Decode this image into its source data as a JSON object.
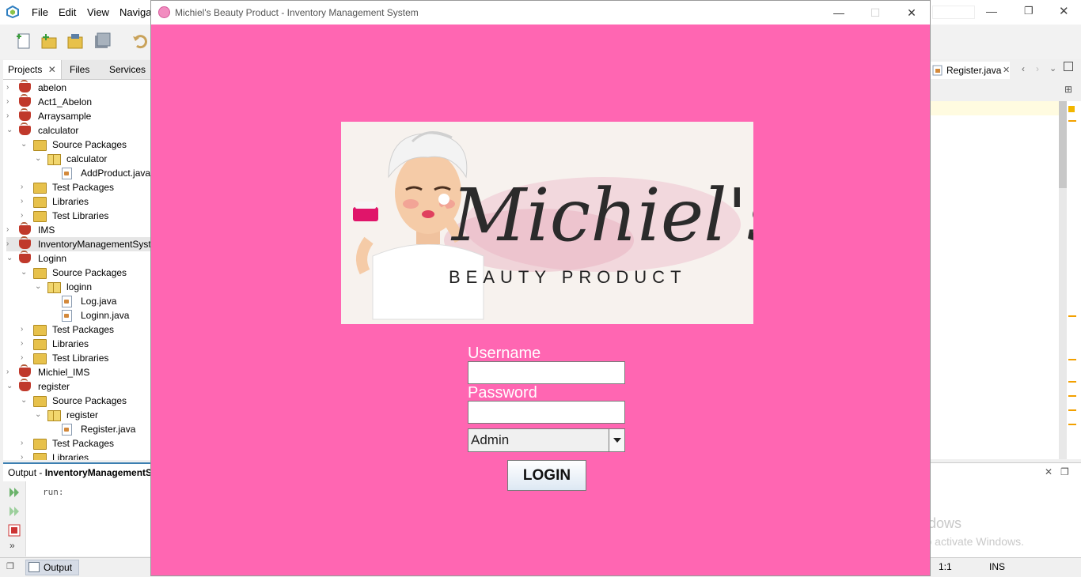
{
  "ide": {
    "menu": [
      "File",
      "Edit",
      "View",
      "Navigat"
    ],
    "left_tabs": [
      "Projects",
      "Files",
      "Services"
    ],
    "tree": [
      {
        "label": "abelon",
        "icon": "project-icon",
        "depth": 0,
        "twisty": "›"
      },
      {
        "label": "Act1_Abelon",
        "icon": "project-icon",
        "depth": 0,
        "twisty": "›"
      },
      {
        "label": "Arraysample",
        "icon": "project-icon",
        "depth": 0,
        "twisty": "›"
      },
      {
        "label": "calculator",
        "icon": "project-icon",
        "depth": 0,
        "twisty": "⌄"
      },
      {
        "label": "Source Packages",
        "icon": "folder-icon",
        "depth": 1,
        "twisty": "⌄"
      },
      {
        "label": "calculator",
        "icon": "package-icon",
        "depth": 2,
        "twisty": "⌄"
      },
      {
        "label": "AddProduct.java",
        "icon": "java-file-icon",
        "depth": 3,
        "twisty": ""
      },
      {
        "label": "Test Packages",
        "icon": "folder-icon",
        "depth": 1,
        "twisty": "›"
      },
      {
        "label": "Libraries",
        "icon": "folder-icon",
        "depth": 1,
        "twisty": "›"
      },
      {
        "label": "Test Libraries",
        "icon": "folder-icon",
        "depth": 1,
        "twisty": "›"
      },
      {
        "label": "IMS",
        "icon": "project-icon",
        "depth": 0,
        "twisty": "›"
      },
      {
        "label": "InventoryManagementSyst",
        "icon": "project-icon",
        "depth": 0,
        "twisty": "›"
      },
      {
        "label": "Loginn",
        "icon": "project-icon",
        "depth": 0,
        "twisty": "⌄"
      },
      {
        "label": "Source Packages",
        "icon": "folder-icon",
        "depth": 1,
        "twisty": "⌄"
      },
      {
        "label": "loginn",
        "icon": "package-icon",
        "depth": 2,
        "twisty": "⌄"
      },
      {
        "label": "Log.java",
        "icon": "java-file-icon",
        "depth": 3,
        "twisty": ""
      },
      {
        "label": "Loginn.java",
        "icon": "java-file-icon",
        "depth": 3,
        "twisty": ""
      },
      {
        "label": "Test Packages",
        "icon": "folder-icon",
        "depth": 1,
        "twisty": "›"
      },
      {
        "label": "Libraries",
        "icon": "folder-icon",
        "depth": 1,
        "twisty": "›"
      },
      {
        "label": "Test Libraries",
        "icon": "folder-icon",
        "depth": 1,
        "twisty": "›"
      },
      {
        "label": "Michiel_IMS",
        "icon": "project-icon",
        "depth": 0,
        "twisty": "›"
      },
      {
        "label": "register",
        "icon": "project-icon",
        "depth": 0,
        "twisty": "⌄"
      },
      {
        "label": "Source Packages",
        "icon": "folder-icon",
        "depth": 1,
        "twisty": "⌄"
      },
      {
        "label": "register",
        "icon": "package-icon",
        "depth": 2,
        "twisty": "⌄"
      },
      {
        "label": "Register.java",
        "icon": "java-file-icon",
        "depth": 3,
        "twisty": ""
      },
      {
        "label": "Test Packages",
        "icon": "folder-icon",
        "depth": 1,
        "twisty": "›"
      },
      {
        "label": "Libraries",
        "icon": "folder-icon",
        "depth": 1,
        "twisty": "›"
      }
    ],
    "output_title_prefix": "Output - ",
    "output_title_project": "InventoryManagementS",
    "output_text": "run:",
    "editor_tab": "Register.java",
    "status_position": "1:1",
    "status_mode": "INS",
    "status_output_tab": "Output",
    "watermark_line1": "Activate Windows",
    "watermark_line2": "Go to Settings to activate Windows."
  },
  "app": {
    "window_title": "Michiel's Beauty Product - Inventory Management System",
    "logo_script": "Michiel's",
    "logo_tagline": "BEAUTY PRODUCT",
    "username_label": "Username",
    "username_value": "",
    "password_label": "Password",
    "password_value": "",
    "role_selected": "Admin",
    "login_label": "LOGIN",
    "bg_color": "#ff66b2"
  }
}
